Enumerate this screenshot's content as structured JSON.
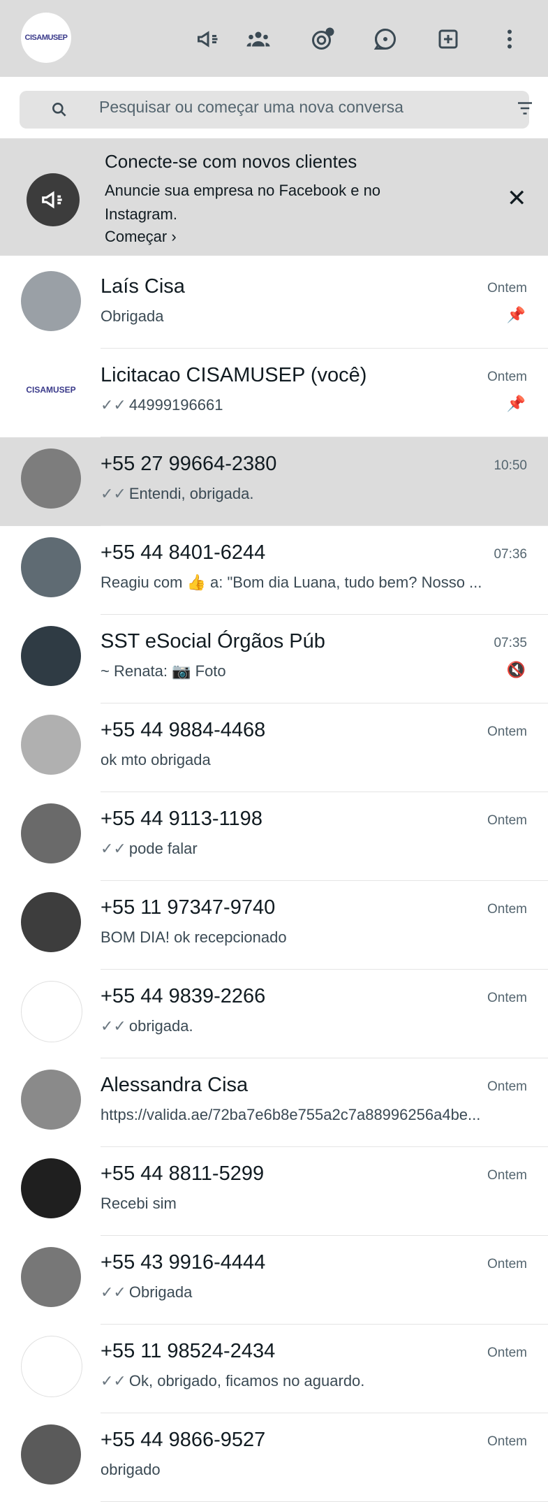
{
  "header": {
    "logo_text": "CISAMUSEP",
    "icons": [
      "megaphone-icon",
      "communities-icon",
      "status-icon",
      "channels-icon",
      "new-chat-icon",
      "menu-icon"
    ]
  },
  "search": {
    "placeholder": "Pesquisar ou começar uma nova conversa"
  },
  "banner": {
    "title": "Conecte-se com novos clientes",
    "text": "Anuncie sua empresa no Facebook e no Instagram.",
    "link": "Começar ›"
  },
  "chats": [
    {
      "name": "Laís Cisa",
      "message": "Obrigada",
      "time": "Ontem",
      "indicator": "📌",
      "ticks": "",
      "avatar": "#9aa0a6"
    },
    {
      "name": "Licitacao CISAMUSEP (você)",
      "message": "44999196661",
      "time": "Ontem",
      "indicator": "📌",
      "ticks": "✓✓",
      "avatar": "logo"
    },
    {
      "name": "+55 27 99664-2380",
      "message": "Entendi, obrigada.",
      "time": "10:50",
      "indicator": "",
      "ticks": "✓✓",
      "avatar": "#7d7d7d",
      "selected": true
    },
    {
      "name": "+55 44 8401-6244",
      "message": "Reagiu com 👍 a: \"Bom dia Luana, tudo bem? Nosso ...",
      "time": "07:36",
      "indicator": "",
      "ticks": "",
      "avatar": "#5f6b73"
    },
    {
      "name": "SST eSocial Órgãos Púb",
      "message": "~ Renata: 📷 Foto",
      "time": "07:35",
      "indicator": "🔇",
      "ticks": "",
      "avatar": "#2f3b44"
    },
    {
      "name": "+55 44 9884-4468",
      "message": "ok mto obrigada",
      "time": "Ontem",
      "indicator": "",
      "ticks": "",
      "avatar": "#b0b0b0"
    },
    {
      "name": "+55 44 9113-1198",
      "message": "pode falar",
      "time": "Ontem",
      "indicator": "",
      "ticks": "✓✓",
      "avatar": "#6a6a6a"
    },
    {
      "name": "+55 11 97347-9740",
      "message": "BOM DIA! ok recepcionado",
      "time": "Ontem",
      "indicator": "",
      "ticks": "",
      "avatar": "#3d3d3d"
    },
    {
      "name": "+55 44 9839-2266",
      "message": "obrigada.",
      "time": "Ontem",
      "indicator": "",
      "ticks": "✓✓",
      "avatar": "#ffffff"
    },
    {
      "name": "Alessandra Cisa",
      "message": "https://valida.ae/72ba7e6b8e755a2c7a88996256a4be...",
      "time": "Ontem",
      "indicator": "",
      "ticks": "",
      "avatar": "#8a8a8a"
    },
    {
      "name": "+55 44 8811-5299",
      "message": "Recebi sim",
      "time": "Ontem",
      "indicator": "",
      "ticks": "",
      "avatar": "#1f1f1f"
    },
    {
      "name": "+55 43 9916-4444",
      "message": "Obrigada",
      "time": "Ontem",
      "indicator": "",
      "ticks": "✓✓",
      "avatar": "#777777"
    },
    {
      "name": "+55 11 98524-2434",
      "message": "Ok, obrigado, ficamos no aguardo.",
      "time": "Ontem",
      "indicator": "",
      "ticks": "✓✓",
      "avatar": "#ffffff"
    },
    {
      "name": "+55 44 9866-9527",
      "message": "obrigado",
      "time": "Ontem",
      "indicator": "",
      "ticks": "",
      "avatar": "#5a5a5a"
    }
  ]
}
